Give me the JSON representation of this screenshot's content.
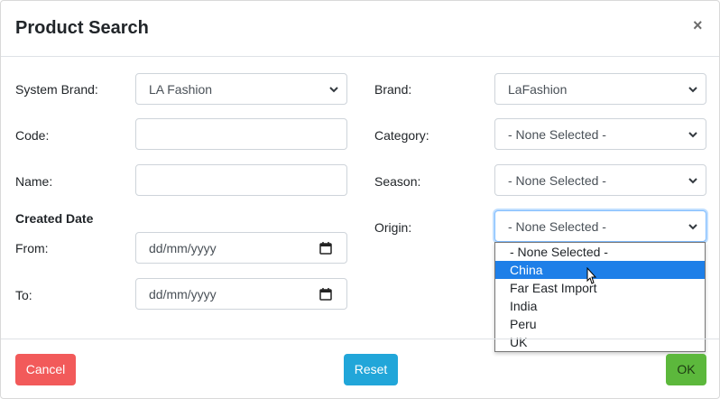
{
  "modal": {
    "title": "Product Search",
    "close_glyph": "×"
  },
  "left_form": {
    "system_brand_label": "System Brand:",
    "system_brand_value": "LA Fashion",
    "code_label": "Code:",
    "code_value": "",
    "name_label": "Name:",
    "name_value": "",
    "created_date_heading": "Created Date",
    "from_label": "From:",
    "from_placeholder": "dd/mm/yyyy",
    "to_label": "To:",
    "to_placeholder": "dd/mm/yyyy"
  },
  "right_form": {
    "brand_label": "Brand:",
    "brand_value": "LaFashion",
    "category_label": "Category:",
    "category_value": "- None Selected -",
    "season_label": "Season:",
    "season_value": "- None Selected -",
    "origin_label": "Origin:",
    "origin_value": "- None Selected -"
  },
  "origin_dropdown": {
    "options": [
      "- None Selected -",
      "China",
      "Far East Import",
      "India",
      "Peru",
      "UK"
    ],
    "highlighted": "China"
  },
  "footer": {
    "cancel_label": "Cancel",
    "reset_label": "Reset",
    "ok_label": "OK"
  },
  "colors": {
    "cancel": "#f25a5a",
    "reset": "#21a6d9",
    "ok": "#5cb83c",
    "highlight": "#1e7fe8"
  },
  "icons": {
    "select_arrow": "chevron-down-icon",
    "date_picker": "calendar-icon",
    "pointer": "mouse-cursor-icon",
    "close": "close-icon"
  }
}
